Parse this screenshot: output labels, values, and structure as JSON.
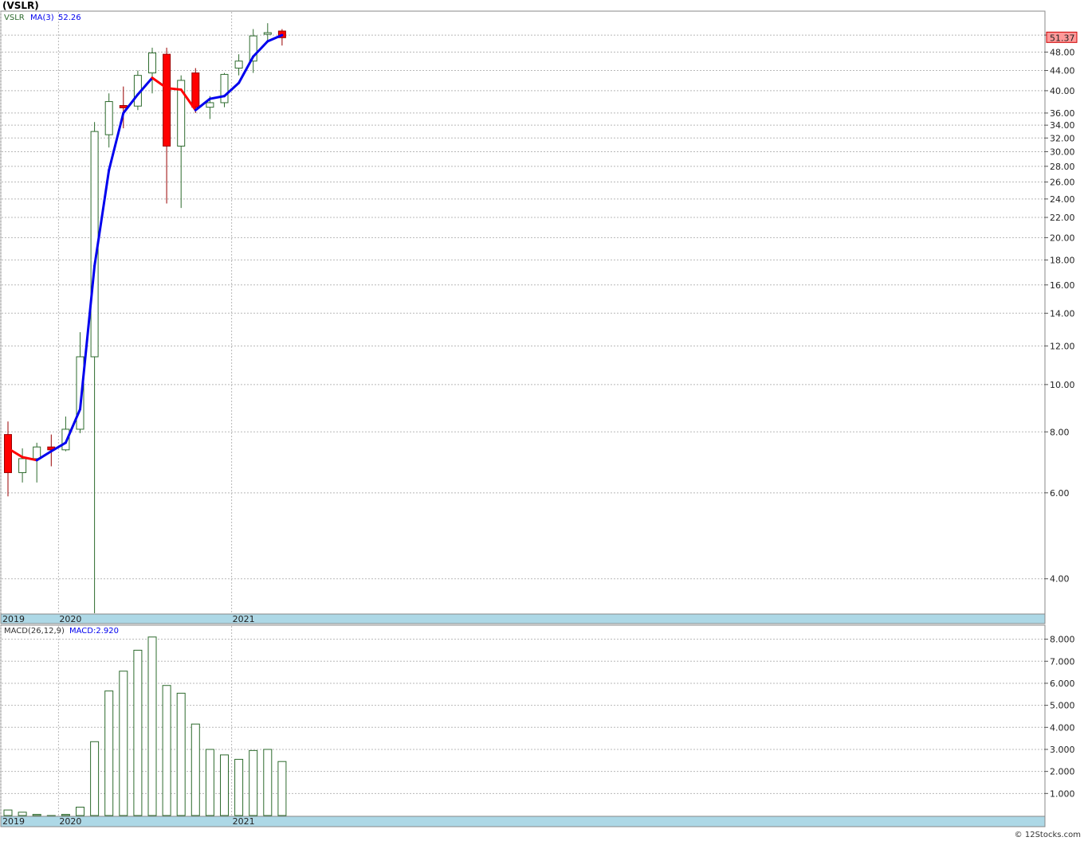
{
  "title": "(VSLR)",
  "credit": "© 12Stocks.com",
  "colors": {
    "up": "#2e6b2e",
    "down": "#ff0000",
    "ma_rising": "#0000ee",
    "ma_falling": "#ff0000",
    "axis_band": "#add8e6",
    "price_badge": "#ff9999",
    "grid": "#b8b8b8"
  },
  "chart_data": [
    {
      "type": "candlestick",
      "panel": "price",
      "symbol_label": "VSLR",
      "indicator_label": "MA(3)",
      "indicator_value": "52.26",
      "last_price": "51.37",
      "scale": "log",
      "ylim": [
        3.4,
        58
      ],
      "yticks": [
        "4.00",
        "6.00",
        "8.00",
        "10.00",
        "12.00",
        "14.00",
        "16.00",
        "18.00",
        "20.00",
        "22.00",
        "24.00",
        "26.00",
        "28.00",
        "30.00",
        "32.00",
        "34.00",
        "36.00",
        "40.00",
        "44.00",
        "48.00",
        "52.00"
      ],
      "x_labels": [
        {
          "label": "2019",
          "index": 0
        },
        {
          "label": "2020",
          "index": 4
        },
        {
          "label": "2021",
          "index": 16
        }
      ],
      "candles": [
        {
          "o": 7.9,
          "h": 8.4,
          "l": 5.9,
          "c": 6.6
        },
        {
          "o": 6.6,
          "h": 7.4,
          "l": 6.3,
          "c": 7.05
        },
        {
          "o": 7.05,
          "h": 7.6,
          "l": 6.3,
          "c": 7.45
        },
        {
          "o": 7.45,
          "h": 7.9,
          "l": 6.8,
          "c": 7.35
        },
        {
          "o": 7.35,
          "h": 8.6,
          "l": 7.3,
          "c": 8.1
        },
        {
          "o": 8.1,
          "h": 12.8,
          "l": 7.95,
          "c": 11.4
        },
        {
          "o": 11.4,
          "h": 34.5,
          "l": 3.4,
          "c": 33.0
        },
        {
          "o": 32.5,
          "h": 39.5,
          "l": 30.6,
          "c": 38.0
        },
        {
          "o": 37.3,
          "h": 40.8,
          "l": 33.5,
          "c": 36.9
        },
        {
          "o": 37.2,
          "h": 44.0,
          "l": 36.5,
          "c": 43.0
        },
        {
          "o": 43.5,
          "h": 49.0,
          "l": 39.5,
          "c": 47.8
        },
        {
          "o": 47.5,
          "h": 49.0,
          "l": 23.5,
          "c": 30.8
        },
        {
          "o": 30.8,
          "h": 43.0,
          "l": 23.0,
          "c": 42.0
        },
        {
          "o": 43.5,
          "h": 44.5,
          "l": 36.0,
          "c": 37.0
        },
        {
          "o": 37.0,
          "h": 39.0,
          "l": 35.0,
          "c": 37.8
        },
        {
          "o": 37.8,
          "h": 43.5,
          "l": 37.0,
          "c": 43.2
        },
        {
          "o": 44.5,
          "h": 47.5,
          "l": 43.0,
          "c": 46.0
        },
        {
          "o": 46.0,
          "h": 53.5,
          "l": 43.5,
          "c": 51.8
        },
        {
          "o": 52.2,
          "h": 55.0,
          "l": 50.5,
          "c": 52.6
        },
        {
          "o": 53.0,
          "h": 53.5,
          "l": 49.5,
          "c": 51.37
        }
      ],
      "ma": [
        7.4,
        7.1,
        7.0,
        7.3,
        7.6,
        8.9,
        17.5,
        27.5,
        36.0,
        39.3,
        42.5,
        40.5,
        40.2,
        36.5,
        38.5,
        39.0,
        41.5,
        47.0,
        50.5,
        52.0
      ]
    },
    {
      "type": "bar",
      "panel": "macd",
      "indicator_label": "MACD(26,12,9)",
      "indicator_value": "MACD:2.920",
      "ylim": [
        0,
        8.6
      ],
      "yticks": [
        "1.000",
        "2.000",
        "3.000",
        "4.000",
        "5.000",
        "6.000",
        "7.000",
        "8.000"
      ],
      "x_labels": [
        {
          "label": "2019",
          "index": 0
        },
        {
          "label": "2020",
          "index": 4
        },
        {
          "label": "2021",
          "index": 16
        }
      ],
      "values": [
        0.25,
        0.15,
        0.05,
        0.0,
        0.05,
        0.38,
        3.35,
        5.65,
        6.55,
        7.5,
        8.1,
        5.9,
        5.55,
        4.15,
        3.0,
        2.75,
        2.55,
        2.95,
        3.0,
        2.45
      ]
    }
  ]
}
